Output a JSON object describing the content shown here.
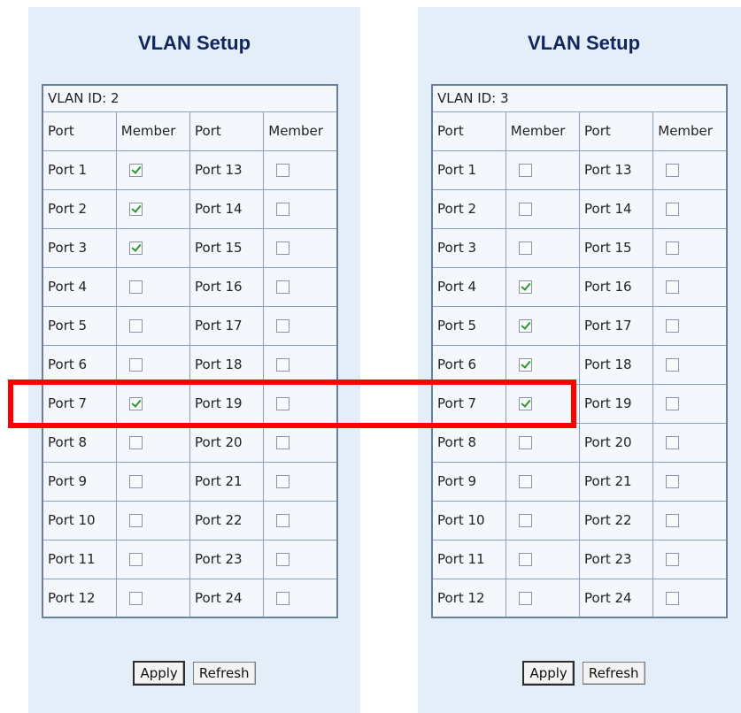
{
  "panels": [
    {
      "title": "VLAN Setup",
      "vlan_id_label": "VLAN ID: 2",
      "headers": [
        "Port",
        "Member",
        "Port",
        "Member"
      ],
      "rows": [
        {
          "left_port": "Port 1",
          "left_checked": true,
          "right_port": "Port 13",
          "right_checked": false
        },
        {
          "left_port": "Port 2",
          "left_checked": true,
          "right_port": "Port 14",
          "right_checked": false
        },
        {
          "left_port": "Port 3",
          "left_checked": true,
          "right_port": "Port 15",
          "right_checked": false
        },
        {
          "left_port": "Port 4",
          "left_checked": false,
          "right_port": "Port 16",
          "right_checked": false
        },
        {
          "left_port": "Port 5",
          "left_checked": false,
          "right_port": "Port 17",
          "right_checked": false
        },
        {
          "left_port": "Port 6",
          "left_checked": false,
          "right_port": "Port 18",
          "right_checked": false
        },
        {
          "left_port": "Port 7",
          "left_checked": true,
          "right_port": "Port 19",
          "right_checked": false
        },
        {
          "left_port": "Port 8",
          "left_checked": false,
          "right_port": "Port 20",
          "right_checked": false
        },
        {
          "left_port": "Port 9",
          "left_checked": false,
          "right_port": "Port 21",
          "right_checked": false
        },
        {
          "left_port": "Port 10",
          "left_checked": false,
          "right_port": "Port 22",
          "right_checked": false
        },
        {
          "left_port": "Port 11",
          "left_checked": false,
          "right_port": "Port 23",
          "right_checked": false
        },
        {
          "left_port": "Port 12",
          "left_checked": false,
          "right_port": "Port 24",
          "right_checked": false
        }
      ],
      "apply_label": "Apply",
      "refresh_label": "Refresh"
    },
    {
      "title": "VLAN Setup",
      "vlan_id_label": "VLAN ID: 3",
      "headers": [
        "Port",
        "Member",
        "Port",
        "Member"
      ],
      "rows": [
        {
          "left_port": "Port 1",
          "left_checked": false,
          "right_port": "Port 13",
          "right_checked": false
        },
        {
          "left_port": "Port 2",
          "left_checked": false,
          "right_port": "Port 14",
          "right_checked": false
        },
        {
          "left_port": "Port 3",
          "left_checked": false,
          "right_port": "Port 15",
          "right_checked": false
        },
        {
          "left_port": "Port 4",
          "left_checked": true,
          "right_port": "Port 16",
          "right_checked": false
        },
        {
          "left_port": "Port 5",
          "left_checked": true,
          "right_port": "Port 17",
          "right_checked": false
        },
        {
          "left_port": "Port 6",
          "left_checked": true,
          "right_port": "Port 18",
          "right_checked": false
        },
        {
          "left_port": "Port 7",
          "left_checked": true,
          "right_port": "Port 19",
          "right_checked": false
        },
        {
          "left_port": "Port 8",
          "left_checked": false,
          "right_port": "Port 20",
          "right_checked": false
        },
        {
          "left_port": "Port 9",
          "left_checked": false,
          "right_port": "Port 21",
          "right_checked": false
        },
        {
          "left_port": "Port 10",
          "left_checked": false,
          "right_port": "Port 22",
          "right_checked": false
        },
        {
          "left_port": "Port 11",
          "left_checked": false,
          "right_port": "Port 23",
          "right_checked": false
        },
        {
          "left_port": "Port 12",
          "left_checked": false,
          "right_port": "Port 24",
          "right_checked": false
        }
      ],
      "apply_label": "Apply",
      "refresh_label": "Refresh"
    }
  ],
  "colors": {
    "panel_background": "#e3eef9",
    "title_text": "#12245e",
    "highlight_border": "#ff0000",
    "checkmark": "#2d9a2d"
  }
}
